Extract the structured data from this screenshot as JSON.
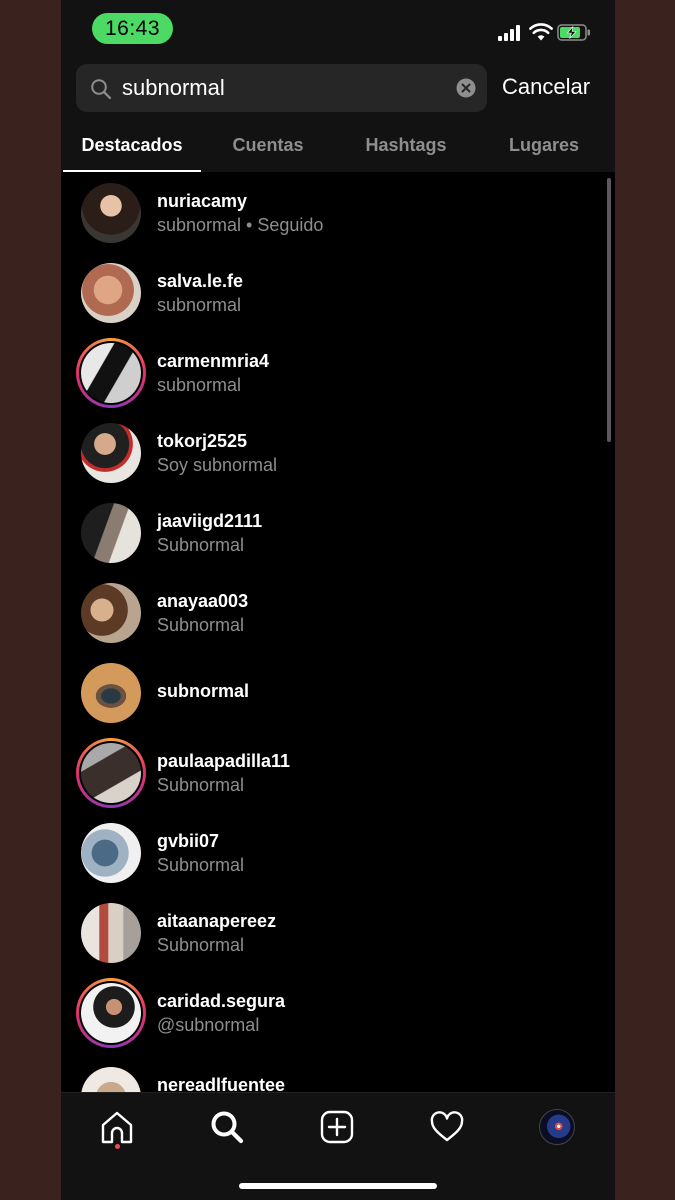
{
  "status_bar": {
    "time": "16:43"
  },
  "search": {
    "query": "subnormal",
    "cancel_label": "Cancelar"
  },
  "tabs": [
    {
      "label": "Destacados",
      "active": true
    },
    {
      "label": "Cuentas",
      "active": false
    },
    {
      "label": "Hashtags",
      "active": false
    },
    {
      "label": "Lugares",
      "active": false
    }
  ],
  "results": [
    {
      "username": "nuriacamy",
      "subtitle": "subnormal • Seguido",
      "story_ring": false
    },
    {
      "username": "salva.le.fe",
      "subtitle": "subnormal",
      "story_ring": false
    },
    {
      "username": "carmenmria4",
      "subtitle": "subnormal",
      "story_ring": true
    },
    {
      "username": "tokorj2525",
      "subtitle": "Soy subnormal",
      "story_ring": false
    },
    {
      "username": "jaaviigd2111",
      "subtitle": "Subnormal",
      "story_ring": false
    },
    {
      "username": "anayaa003",
      "subtitle": "Subnormal",
      "story_ring": false
    },
    {
      "username": "subnormal",
      "subtitle": "",
      "story_ring": false
    },
    {
      "username": "paulaapadilla11",
      "subtitle": "Subnormal",
      "story_ring": true
    },
    {
      "username": "gvbii07",
      "subtitle": "Subnormal",
      "story_ring": false
    },
    {
      "username": "aitaanapereez",
      "subtitle": "Subnormal",
      "story_ring": false
    },
    {
      "username": "caridad.segura",
      "subtitle": "@subnormal",
      "story_ring": true
    },
    {
      "username": "nereadlfuentee",
      "subtitle": "",
      "story_ring": false
    }
  ],
  "bottom_nav": [
    {
      "icon": "home-icon",
      "active": false
    },
    {
      "icon": "search-icon",
      "active": true
    },
    {
      "icon": "add-post-icon",
      "active": false
    },
    {
      "icon": "heart-icon",
      "active": false
    },
    {
      "icon": "profile-avatar",
      "active": false
    }
  ],
  "colors": {
    "background": "#000000",
    "bar_background": "#121212",
    "search_field": "#262626",
    "secondary_text": "#8e8e8e",
    "status_pill": "#4cd964",
    "notification_dot": "#ed4956"
  }
}
